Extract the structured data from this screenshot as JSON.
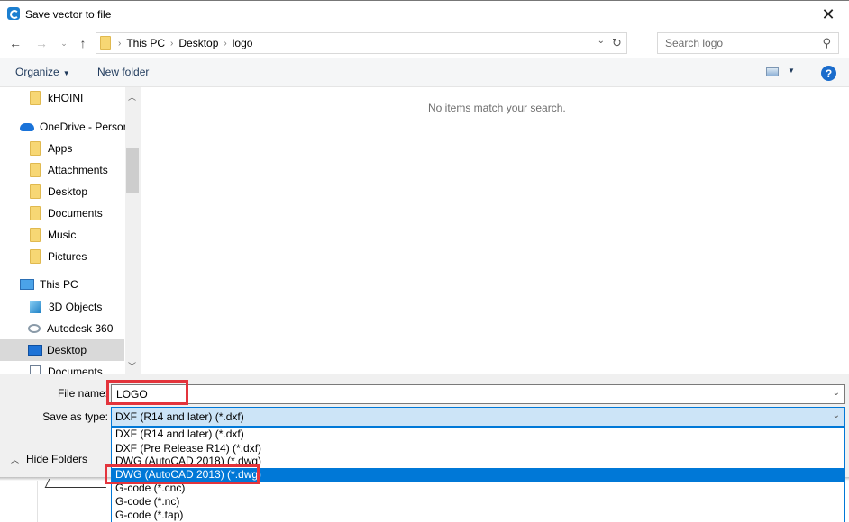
{
  "window": {
    "title": "Save vector to file",
    "close_icon": "close-icon"
  },
  "nav": {
    "back_icon": "arrow-left-icon",
    "forward_icon": "arrow-right-icon",
    "recent_icon": "chevron-down-icon",
    "up_icon": "arrow-up-icon",
    "breadcrumb": [
      "This PC",
      "Desktop",
      "logo"
    ],
    "refresh_icon": "refresh-icon",
    "search_placeholder": "Search logo",
    "search_icon": "search-icon"
  },
  "toolbar": {
    "organize_label": "Organize",
    "new_folder_label": "New folder",
    "help_label": "?"
  },
  "sidebar": {
    "items": [
      {
        "label": "kHOINI",
        "icon": "folder-icon"
      },
      {
        "label": "OneDrive - Person",
        "icon": "cloud-icon"
      },
      {
        "label": "Apps",
        "icon": "folder-icon"
      },
      {
        "label": "Attachments",
        "icon": "folder-icon"
      },
      {
        "label": "Desktop",
        "icon": "folder-icon"
      },
      {
        "label": "Documents",
        "icon": "folder-icon"
      },
      {
        "label": "Music",
        "icon": "folder-icon"
      },
      {
        "label": "Pictures",
        "icon": "folder-icon"
      },
      {
        "label": "This PC",
        "icon": "computer-icon"
      },
      {
        "label": "3D Objects",
        "icon": "cube-icon"
      },
      {
        "label": "Autodesk 360",
        "icon": "autodesk-360-icon"
      },
      {
        "label": "Desktop",
        "icon": "desktop-icon",
        "selected": true
      },
      {
        "label": "Documents",
        "icon": "document-icon"
      }
    ]
  },
  "content": {
    "empty_message": "No items match your search."
  },
  "footer": {
    "file_name_label": "File name:",
    "file_name_value": "LOGO",
    "save_type_label": "Save as type:",
    "save_type_value": "DXF (R14 and later) (*.dxf)",
    "hide_folders_label": "Hide Folders"
  },
  "dropdown": {
    "options": [
      "DXF (R14 and later) (*.dxf)",
      "DXF (Pre Release R14) (*.dxf)",
      "DWG (AutoCAD 2018) (*.dwg)",
      "DWG (AutoCAD 2013) (*.dwg)",
      "G-code (*.cnc)",
      "G-code (*.nc)",
      "G-code (*.tap)"
    ],
    "highlighted_index": 3
  },
  "colors": {
    "accent": "#0078d7",
    "annotation_red": "#e3343c",
    "selected_bg": "#cce4f7"
  }
}
